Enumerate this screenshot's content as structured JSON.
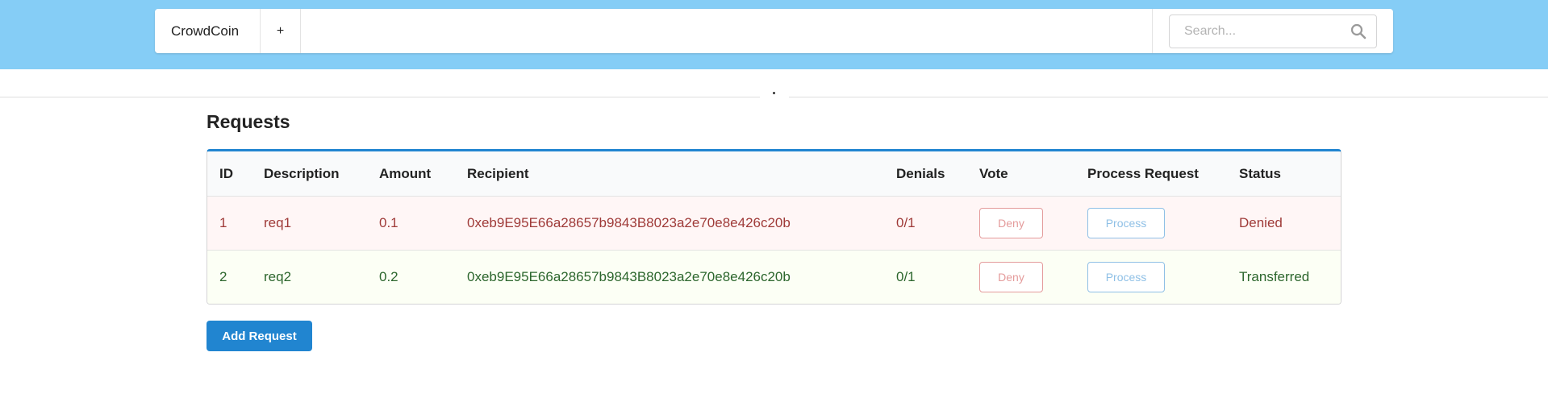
{
  "nav": {
    "brand": "CrowdCoin",
    "plus": "+",
    "search_placeholder": "Search..."
  },
  "page": {
    "title": "Requests",
    "add_button": "Add Request"
  },
  "table": {
    "headers": [
      "ID",
      "Description",
      "Amount",
      "Recipient",
      "Denials",
      "Vote",
      "Process Request",
      "Status"
    ],
    "rows": [
      {
        "id": "1",
        "description": "req1",
        "amount": "0.1",
        "recipient": "0xeb9E95E66a28657b9843B8023a2e70e8e426c20b",
        "denials": "0/1",
        "vote_label": "Deny",
        "process_label": "Process",
        "status": "Denied"
      },
      {
        "id": "2",
        "description": "req2",
        "amount": "0.2",
        "recipient": "0xeb9E95E66a28657b9843B8023a2e70e8e426c20b",
        "denials": "0/1",
        "vote_label": "Deny",
        "process_label": "Process",
        "status": "Transferred"
      }
    ]
  },
  "colors": {
    "header_band": "#85cdf6",
    "primary": "#2185d0",
    "denied_text": "#9f3a38",
    "transferred_text": "#2c662d"
  }
}
